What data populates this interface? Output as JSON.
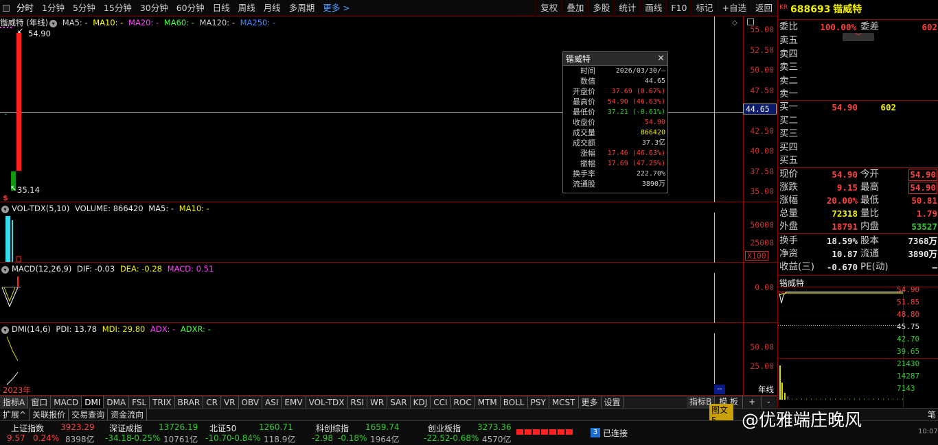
{
  "menu": {
    "left": [
      "分时",
      "1分钟",
      "5分钟",
      "15分钟",
      "30分钟",
      "60分钟",
      "日线",
      "周线",
      "月线",
      "多周期"
    ],
    "more": "更多 >",
    "right": [
      "复权",
      "叠加",
      "多股",
      "统计",
      "画线",
      "F10",
      "标记",
      "+自选",
      "返回"
    ]
  },
  "main_chart": {
    "title": "锴威特 (年线)",
    "ma": [
      "MA5: -",
      "MA10: -",
      "MA20: -",
      "MA60: -",
      "MA120: -",
      "MA250: -"
    ],
    "ma_colors": [
      "#d0d0d0",
      "#ffff00",
      "#ff44ff",
      "#44ff44",
      "#d0d0d0",
      "#4488ff"
    ],
    "ticks": [
      "55.00",
      "52.50",
      "50.00",
      "47.50",
      "45.00",
      "42.50",
      "40.00",
      "37.50",
      "35.00"
    ],
    "high_label": "54.90",
    "low_label": "35.14",
    "cursor_value": "44.65",
    "candles": [
      {
        "open": 37.69,
        "high": 54.9,
        "low": 37.21,
        "close": 54.9
      },
      {
        "open": 37.5,
        "high": 37.5,
        "low": 35.14,
        "close": 35.14
      }
    ]
  },
  "tooltip": {
    "title": "锴威特",
    "rows": [
      {
        "k": "时间",
        "v": "2026/03/30/—",
        "c": "#d0d0d0"
      },
      {
        "k": "数值",
        "v": "44.65",
        "c": "#d0d0d0"
      },
      {
        "k": "开盘价",
        "v": "37.69 (0.67%)",
        "c": "#ff4040"
      },
      {
        "k": "最高价",
        "v": "54.90 (46.63%)",
        "c": "#ff4040"
      },
      {
        "k": "最低价",
        "v": "37.21 (-0.61%)",
        "c": "#33cc33"
      },
      {
        "k": "收盘价",
        "v": "54.90",
        "c": "#ff4040"
      },
      {
        "k": "成交量",
        "v": "866420",
        "c": "#f0f000"
      },
      {
        "k": "成交额",
        "v": "37.3亿",
        "c": "#d0d0d0"
      },
      {
        "k": "涨幅",
        "v": "17.46 (46.63%)",
        "c": "#ff4040"
      },
      {
        "k": "振幅",
        "v": "17.69 (47.25%)",
        "c": "#ff4040"
      },
      {
        "k": "换手率",
        "v": "222.70%",
        "c": "#d0d0d0"
      },
      {
        "k": "流通股",
        "v": "3890万",
        "c": "#d0d0d0"
      }
    ]
  },
  "vol": {
    "legend": "VOL-TDX(5,10)",
    "volume": "VOLUME: 866420",
    "ma5": "MA5: -",
    "ma10": "MA10: -",
    "ticks": [
      "50000",
      "25000"
    ],
    "unit": "X100"
  },
  "macd": {
    "legend": "MACD(12,26,9)",
    "dif": "DIF: -0.03",
    "dea": "DEA: -0.28",
    "macd": "MACD: 0.51",
    "ticks": [
      "0.00"
    ]
  },
  "dmi": {
    "legend": "DMI(14,6)",
    "pdi": "PDI: 13.78",
    "mdi": "MDI: 29.80",
    "adx": "ADX: -",
    "adxr": "ADXR: -",
    "ticks": [
      "50.00",
      "25.00"
    ],
    "year": "2023年",
    "period": "年线",
    "cursor_tag": "--"
  },
  "tabs": [
    "指标A",
    "窗口",
    "MACD",
    "DMI",
    "DMA",
    "FSL",
    "TRIX",
    "BRAR",
    "CR",
    "VR",
    "OBV",
    "ASI",
    "EMV",
    "VOL-TDX",
    "RSI",
    "WR",
    "SAR",
    "KDJ",
    "CCI",
    "ROC",
    "MTM",
    "BOLL",
    "PSY",
    "MCST",
    "更多",
    "设置"
  ],
  "tabs_right": [
    "指标B",
    "模 板",
    "+",
    "-"
  ],
  "tabs2": [
    "扩展^",
    "关联报价",
    "交易查询",
    "资金流向"
  ],
  "tabs2_right": [
    "图文F",
    "笔"
  ],
  "quote": {
    "market": "KR",
    "code": "688693",
    "name": "锴威特",
    "wb_label": "委比",
    "wb": "100.00%",
    "wc_label": "委差",
    "wc": "602",
    "sells": [
      "卖五",
      "卖四",
      "卖三",
      "卖二",
      "卖一"
    ],
    "buys": [
      {
        "label": "买一",
        "price": "54.90",
        "vol": "602"
      },
      {
        "label": "买二",
        "price": "",
        "vol": ""
      },
      {
        "label": "买三",
        "price": "",
        "vol": ""
      },
      {
        "label": "买四",
        "price": "",
        "vol": ""
      },
      {
        "label": "买五",
        "price": "",
        "vol": ""
      }
    ],
    "stats": [
      {
        "l1": "现价",
        "v1": "54.90",
        "c1": "#ff4040",
        "l2": "今开",
        "v2": "54.90",
        "c2": "#ff4040",
        "box": true
      },
      {
        "l1": "涨跌",
        "v1": "9.15",
        "c1": "#ff4040",
        "l2": "最高",
        "v2": "54.90",
        "c2": "#ff4040",
        "box": true
      },
      {
        "l1": "涨幅",
        "v1": "20.00%",
        "c1": "#ff4040",
        "l2": "最低",
        "v2": "50.81",
        "c2": "#ff4040"
      },
      {
        "l1": "总量",
        "v1": "72318",
        "c1": "#f0f000",
        "l2": "量比",
        "v2": "1.79",
        "c2": "#ff4040"
      },
      {
        "l1": "外盘",
        "v1": "18791",
        "c1": "#ff4040",
        "l2": "内盘",
        "v2": "53527",
        "c2": "#33cc33"
      }
    ],
    "stats2": [
      {
        "l1": "换手",
        "v1": "18.59%",
        "c1": "#e8e8e8",
        "l2": "股本",
        "v2": "7368万",
        "c2": "#e8e8e8"
      },
      {
        "l1": "净资",
        "v1": "10.87",
        "c1": "#e8e8e8",
        "l2": "流通",
        "v2": "3890万",
        "c2": "#e8e8e8"
      },
      {
        "l1": "收益(三)",
        "v1": "-0.670",
        "c1": "#e8e8e8",
        "l2": "PE(动)",
        "v2": "—",
        "c2": "#e8e8e8"
      }
    ],
    "mini_title": "锴威特",
    "mini_ticks": [
      "54.90",
      "51.85",
      "48.80",
      "45.75",
      "42.70",
      "39.65"
    ],
    "mini_vol_ticks": [
      "21430",
      "14287",
      "7143"
    ]
  },
  "indices": [
    {
      "name": "上证指数",
      "val": "3923.29",
      "chg": "9.57",
      "pct": "0.24%",
      "amt": "8398亿",
      "up": true
    },
    {
      "name": "深证成指",
      "val": "13726.19",
      "chg": "-34.18",
      "pct": "-0.25%",
      "amt": "10761亿",
      "up": false
    },
    {
      "name": "北证50",
      "val": "1260.71",
      "chg": "-10.70",
      "pct": "-0.84%",
      "amt": "118.9亿",
      "up": false
    },
    {
      "name": "科创综指",
      "val": "1659.74",
      "chg": "-2.98",
      "pct": "-0.18%",
      "amt": "1964亿",
      "up": false
    },
    {
      "name": "创业板指",
      "val": "3273.36",
      "chg": "-22.52",
      "pct": "-0.68%",
      "amt": "4570亿",
      "up": false
    }
  ],
  "status": {
    "badge": "3",
    "text": "已连接",
    "watermark": "@优雅端庄晚风",
    "clock": "10:07"
  }
}
